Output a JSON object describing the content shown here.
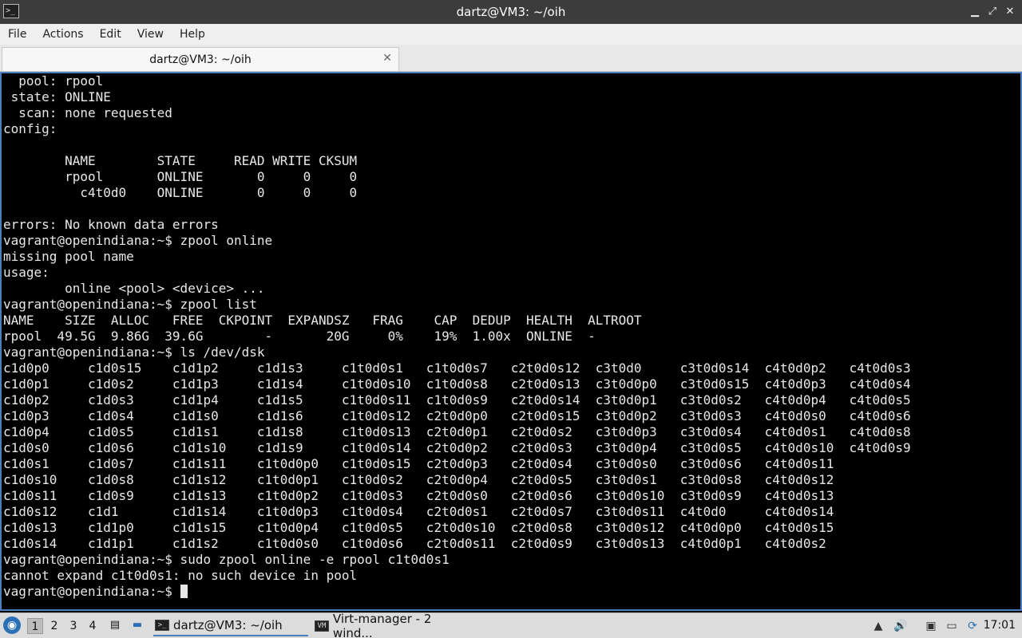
{
  "window": {
    "title": "dartz@VM3: ~/oih",
    "app_icon_glyph": ">_",
    "controls": {
      "minimize": "▁",
      "restore": "⤢",
      "close": "✕"
    }
  },
  "menubar": {
    "items": [
      "File",
      "Actions",
      "Edit",
      "View",
      "Help"
    ]
  },
  "tab": {
    "label": "dartz@VM3: ~/oih",
    "close_glyph": "✕"
  },
  "terminal": {
    "lines": [
      "  pool: rpool",
      " state: ONLINE",
      "  scan: none requested",
      "config:",
      "",
      "        NAME        STATE     READ WRITE CKSUM",
      "        rpool       ONLINE       0     0     0",
      "          c4t0d0    ONLINE       0     0     0",
      "",
      "errors: No known data errors",
      "vagrant@openindiana:~$ zpool online",
      "missing pool name",
      "usage:",
      "        online <pool> <device> ...",
      "vagrant@openindiana:~$ zpool list",
      "NAME    SIZE  ALLOC   FREE  CKPOINT  EXPANDSZ   FRAG    CAP  DEDUP  HEALTH  ALTROOT",
      "rpool  49.5G  9.86G  39.6G        -       20G     0%    19%  1.00x  ONLINE  -",
      "vagrant@openindiana:~$ ls /dev/dsk",
      "c1d0p0     c1d0s15    c1d1p2     c1d1s3     c1t0d0s1   c1t0d0s7   c2t0d0s12  c3t0d0     c3t0d0s14  c4t0d0p2   c4t0d0s3",
      "c1d0p1     c1d0s2     c1d1p3     c1d1s4     c1t0d0s10  c1t0d0s8   c2t0d0s13  c3t0d0p0   c3t0d0s15  c4t0d0p3   c4t0d0s4",
      "c1d0p2     c1d0s3     c1d1p4     c1d1s5     c1t0d0s11  c1t0d0s9   c2t0d0s14  c3t0d0p1   c3t0d0s2   c4t0d0p4   c4t0d0s5",
      "c1d0p3     c1d0s4     c1d1s0     c1d1s6     c1t0d0s12  c2t0d0p0   c2t0d0s15  c3t0d0p2   c3t0d0s3   c4t0d0s0   c4t0d0s6",
      "c1d0p4     c1d0s5     c1d1s1     c1d1s8     c1t0d0s13  c2t0d0p1   c2t0d0s2   c3t0d0p3   c3t0d0s4   c4t0d0s1   c4t0d0s8",
      "c1d0s0     c1d0s6     c1d1s10    c1d1s9     c1t0d0s14  c2t0d0p2   c2t0d0s3   c3t0d0p4   c3t0d0s5   c4t0d0s10  c4t0d0s9",
      "c1d0s1     c1d0s7     c1d1s11    c1t0d0p0   c1t0d0s15  c2t0d0p3   c2t0d0s4   c3t0d0s0   c3t0d0s6   c4t0d0s11",
      "c1d0s10    c1d0s8     c1d1s12    c1t0d0p1   c1t0d0s2   c2t0d0p4   c2t0d0s5   c3t0d0s1   c3t0d0s8   c4t0d0s12",
      "c1d0s11    c1d0s9     c1d1s13    c1t0d0p2   c1t0d0s3   c2t0d0s0   c2t0d0s6   c3t0d0s10  c3t0d0s9   c4t0d0s13",
      "c1d0s12    c1d1       c1d1s14    c1t0d0p3   c1t0d0s4   c2t0d0s1   c2t0d0s7   c3t0d0s11  c4t0d0     c4t0d0s14",
      "c1d0s13    c1d1p0     c1d1s15    c1t0d0p4   c1t0d0s5   c2t0d0s10  c2t0d0s8   c3t0d0s12  c4t0d0p0   c4t0d0s15",
      "c1d0s14    c1d1p1     c1d1s2     c1t0d0s0   c1t0d0s6   c2t0d0s11  c2t0d0s9   c3t0d0s13  c4t0d0p1   c4t0d0s2",
      "vagrant@openindiana:~$ sudo zpool online -e rpool c1t0d0s1",
      "cannot expand c1t0d0s1: no such device in pool"
    ],
    "prompt": "vagrant@openindiana:~$ "
  },
  "taskbar": {
    "start_glyph": "◉",
    "workspaces": [
      "1",
      "2",
      "3",
      "4"
    ],
    "active_workspace": "1",
    "launchers": {
      "files_icon": "▤",
      "desktop_icon": "▬"
    },
    "tasks": [
      {
        "label": "dartz@VM3: ~/oih",
        "icon": ">_"
      },
      {
        "label": "Virt-manager - 2 wind...",
        "icon": "VM"
      }
    ],
    "tray": {
      "up_icon": "▲",
      "volume_icon": "🔊",
      "clipboard_icon": "▣",
      "network_icon": "▭",
      "update_icon": "⟳"
    },
    "clock": "17:01"
  }
}
